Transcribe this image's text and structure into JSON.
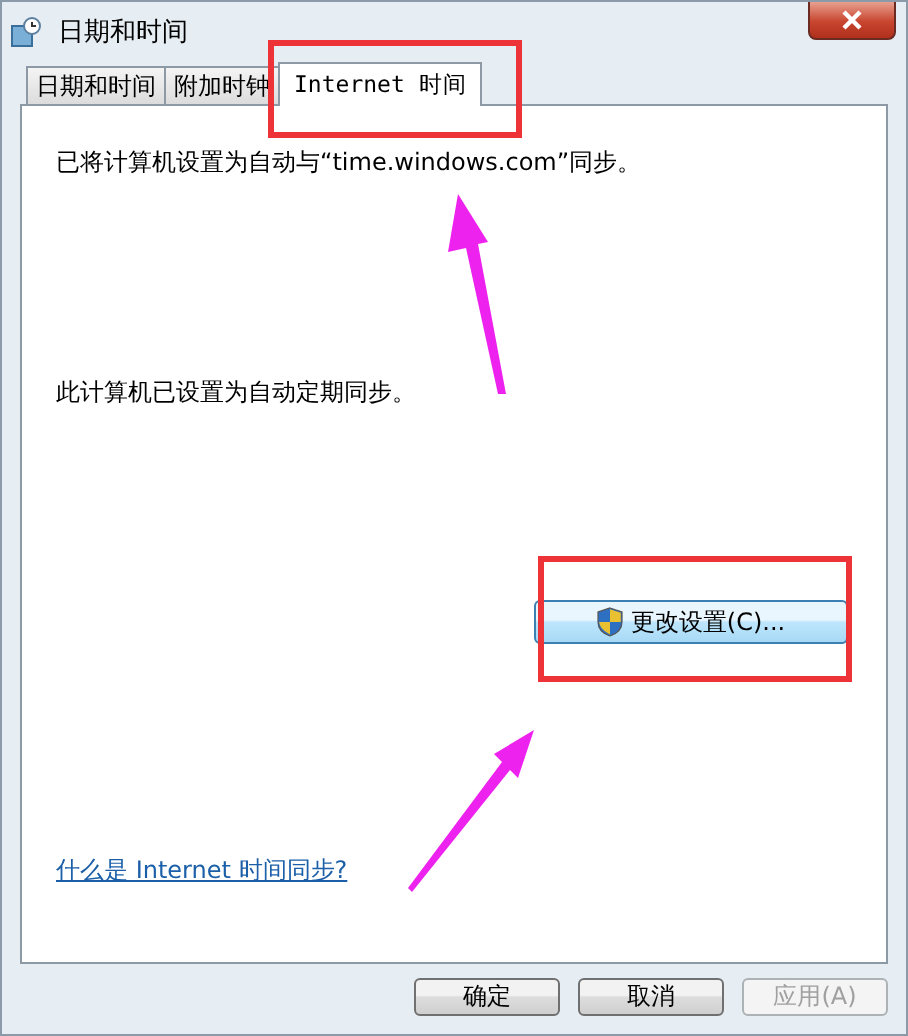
{
  "window": {
    "title": "日期和时间"
  },
  "tabs": [
    {
      "label": "日期和时间",
      "selected": false
    },
    {
      "label": "附加时钟",
      "selected": false
    },
    {
      "label": "Internet 时间",
      "selected": true
    }
  ],
  "status_text": "已将计算机设置为自动与“time.windows.com”同步。",
  "sync_text": "此计算机已设置为自动定期同步。",
  "change_button": {
    "label": "更改设置(C)..."
  },
  "help_link": "什么是 Internet 时间同步?",
  "buttons": [
    {
      "label": "确定",
      "disabled": false
    },
    {
      "label": "取消",
      "disabled": false
    },
    {
      "label": "应用(A)",
      "disabled": true
    }
  ]
}
